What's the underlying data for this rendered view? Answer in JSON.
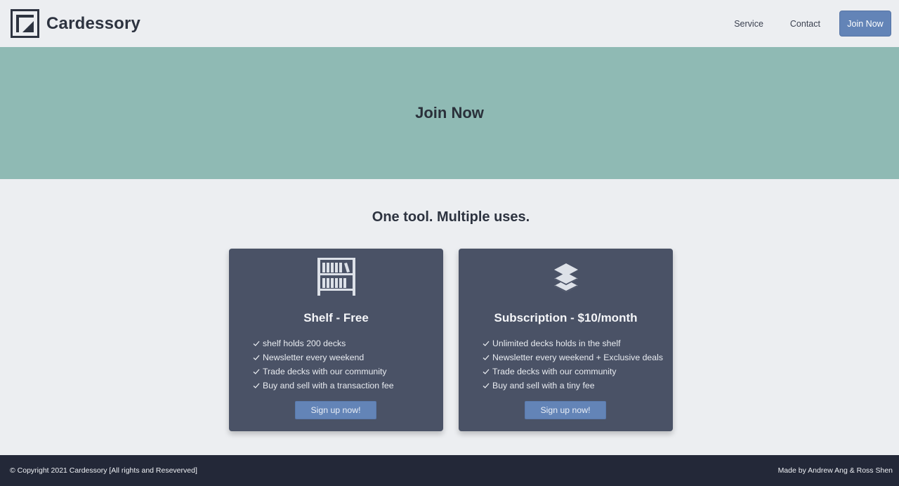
{
  "header": {
    "brand_name": "Cardessory",
    "nav": {
      "service": "Service",
      "contact": "Contact",
      "join": "Join Now"
    }
  },
  "hero": {
    "title": "Join Now"
  },
  "section": {
    "title": "One tool. Multiple uses."
  },
  "plans": [
    {
      "icon": "bookshelf-icon",
      "title": "Shelf - Free",
      "features": [
        "shelf holds 200 decks",
        "Newsletter every weekend",
        "Trade decks with our community",
        "Buy and sell with a transaction fee"
      ],
      "button": "Sign up now!"
    },
    {
      "icon": "layers-icon",
      "title": "Subscription - $10/month",
      "features": [
        "Unlimited decks holds in the shelf",
        "Newsletter every weekend + Exclusive deals",
        "Trade decks with our community",
        "Buy and sell with a tiny fee"
      ],
      "button": "Sign up now!"
    }
  ],
  "footer": {
    "copyright": "© Copyright 2021 Cardessory [All rights and Reseverved]",
    "credits": "Made by Andrew Ang & Ross Shen"
  },
  "colors": {
    "hero_bg": "#8fbab4",
    "card_bg": "#4a5266",
    "accent": "#6384b7",
    "footer_bg": "#232838",
    "page_bg": "#eceef1"
  }
}
